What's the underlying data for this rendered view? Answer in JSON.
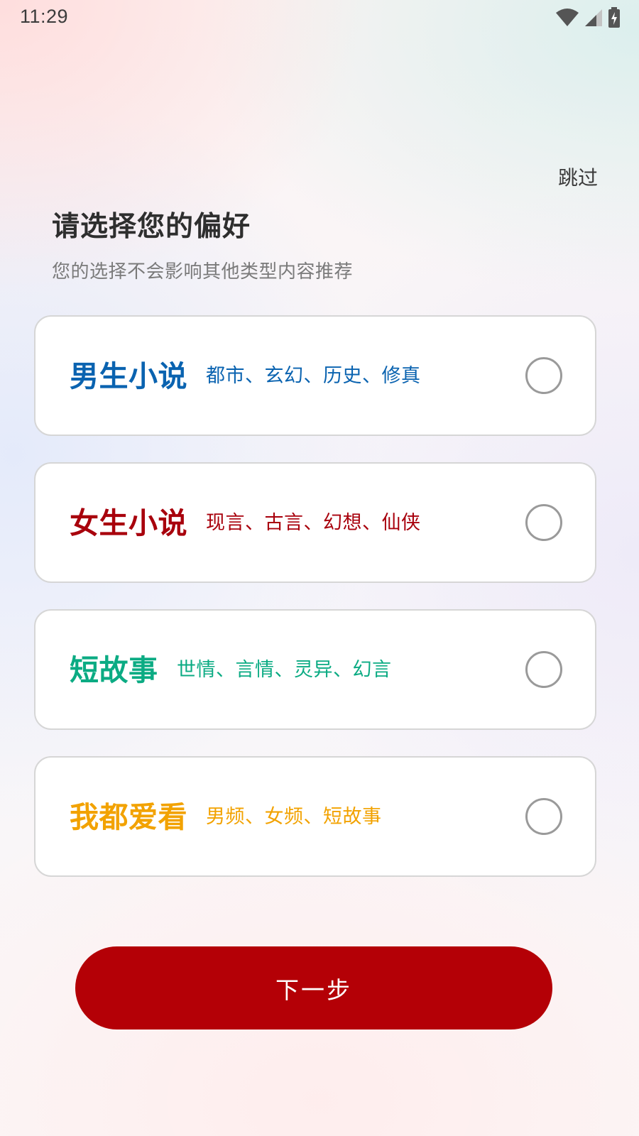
{
  "status_bar": {
    "time": "11:29",
    "icons": [
      "wifi-icon",
      "signal-icon",
      "battery-charging-icon"
    ]
  },
  "header": {
    "skip_label": "跳过",
    "title": "请选择您的偏好",
    "subtitle": "您的选择不会影响其他类型内容推荐"
  },
  "options": [
    {
      "title": "男生小说",
      "tags": "都市、玄幻、历史、修真",
      "color": "#0a63b0",
      "selected": false
    },
    {
      "title": "女生小说",
      "tags": "现言、古言、幻想、仙侠",
      "color": "#a8000c",
      "selected": false
    },
    {
      "title": "短故事",
      "tags": "世情、言情、灵异、幻言",
      "color": "#0bab83",
      "selected": false
    },
    {
      "title": "我都爱看",
      "tags": "男频、女频、短故事",
      "color": "#f2a200",
      "selected": false
    }
  ],
  "footer": {
    "next_label": "下一步",
    "button_color": "#b40006"
  }
}
